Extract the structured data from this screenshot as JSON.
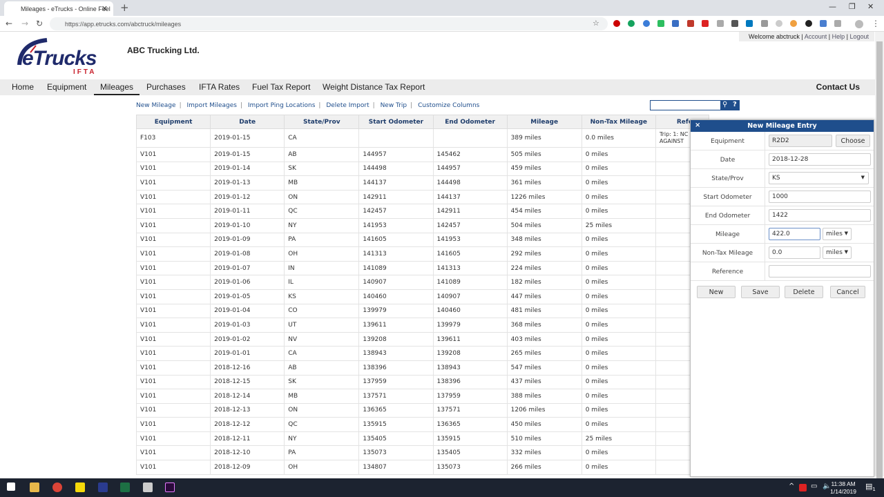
{
  "browser": {
    "tab_title": "Mileages - eTrucks - Online Fuel",
    "url": "https://app.etrucks.com/abctruck/mileages"
  },
  "colors": {
    "brand": "#1f4e8c",
    "accent": "#c8202c"
  },
  "header": {
    "logo_text": "eTrucks",
    "logo_sub": "IFTA",
    "company": "ABC Trucking Ltd.",
    "welcome": "Welcome abctruck",
    "account": "Account",
    "help": "Help",
    "logout": "Logout"
  },
  "menu": {
    "items": [
      "Home",
      "Equipment",
      "Mileages",
      "Purchases",
      "IFTA Rates",
      "Fuel Tax Report",
      "Weight Distance Tax Report"
    ],
    "active": "Mileages",
    "contact": "Contact Us"
  },
  "actions": [
    "New Mileage",
    "Import Mileages",
    "Import Ping Locations",
    "Delete Import",
    "New Trip",
    "Customize Columns"
  ],
  "search": {
    "value": "",
    "search_icon": "search-icon",
    "help": "?"
  },
  "table": {
    "headers": [
      "Equipment",
      "Date",
      "State/Prov",
      "Start Odometer",
      "End Odometer",
      "Mileage",
      "Non-Tax Mileage",
      "Refe"
    ],
    "rows": [
      [
        "F103",
        "2019-01-15",
        "CA",
        "",
        "",
        "389 miles",
        "0.0 miles",
        "Trip: 1: NC AGAINST"
      ],
      [
        "V101",
        "2019-01-15",
        "AB",
        "144957",
        "145462",
        "505 miles",
        "0 miles",
        ""
      ],
      [
        "V101",
        "2019-01-14",
        "SK",
        "144498",
        "144957",
        "459 miles",
        "0 miles",
        ""
      ],
      [
        "V101",
        "2019-01-13",
        "MB",
        "144137",
        "144498",
        "361 miles",
        "0 miles",
        ""
      ],
      [
        "V101",
        "2019-01-12",
        "ON",
        "142911",
        "144137",
        "1226 miles",
        "0 miles",
        ""
      ],
      [
        "V101",
        "2019-01-11",
        "QC",
        "142457",
        "142911",
        "454 miles",
        "0 miles",
        ""
      ],
      [
        "V101",
        "2019-01-10",
        "NY",
        "141953",
        "142457",
        "504 miles",
        "25 miles",
        ""
      ],
      [
        "V101",
        "2019-01-09",
        "PA",
        "141605",
        "141953",
        "348 miles",
        "0 miles",
        ""
      ],
      [
        "V101",
        "2019-01-08",
        "OH",
        "141313",
        "141605",
        "292 miles",
        "0 miles",
        ""
      ],
      [
        "V101",
        "2019-01-07",
        "IN",
        "141089",
        "141313",
        "224 miles",
        "0 miles",
        ""
      ],
      [
        "V101",
        "2019-01-06",
        "IL",
        "140907",
        "141089",
        "182 miles",
        "0 miles",
        ""
      ],
      [
        "V101",
        "2019-01-05",
        "KS",
        "140460",
        "140907",
        "447 miles",
        "0 miles",
        ""
      ],
      [
        "V101",
        "2019-01-04",
        "CO",
        "139979",
        "140460",
        "481 miles",
        "0 miles",
        ""
      ],
      [
        "V101",
        "2019-01-03",
        "UT",
        "139611",
        "139979",
        "368 miles",
        "0 miles",
        ""
      ],
      [
        "V101",
        "2019-01-02",
        "NV",
        "139208",
        "139611",
        "403 miles",
        "0 miles",
        ""
      ],
      [
        "V101",
        "2019-01-01",
        "CA",
        "138943",
        "139208",
        "265 miles",
        "0 miles",
        ""
      ],
      [
        "V101",
        "2018-12-16",
        "AB",
        "138396",
        "138943",
        "547 miles",
        "0 miles",
        ""
      ],
      [
        "V101",
        "2018-12-15",
        "SK",
        "137959",
        "138396",
        "437 miles",
        "0 miles",
        ""
      ],
      [
        "V101",
        "2018-12-14",
        "MB",
        "137571",
        "137959",
        "388 miles",
        "0 miles",
        ""
      ],
      [
        "V101",
        "2018-12-13",
        "ON",
        "136365",
        "137571",
        "1206 miles",
        "0 miles",
        ""
      ],
      [
        "V101",
        "2018-12-12",
        "QC",
        "135915",
        "136365",
        "450 miles",
        "0 miles",
        ""
      ],
      [
        "V101",
        "2018-12-11",
        "NY",
        "135405",
        "135915",
        "510 miles",
        "25 miles",
        ""
      ],
      [
        "V101",
        "2018-12-10",
        "PA",
        "135073",
        "135405",
        "332 miles",
        "0 miles",
        ""
      ],
      [
        "V101",
        "2018-12-09",
        "OH",
        "134807",
        "135073",
        "266 miles",
        "0 miles",
        ""
      ]
    ]
  },
  "dialog": {
    "title": "New Mileage Entry",
    "close": "×",
    "fields": {
      "equipment_label": "Equipment",
      "equipment": "R2D2",
      "choose": "Choose",
      "date_label": "Date",
      "date": "2018-12-28",
      "state_label": "State/Prov",
      "state": "KS",
      "start_label": "Start Odometer",
      "start": "1000",
      "end_label": "End Odometer",
      "end": "1422",
      "mileage_label": "Mileage",
      "mileage": "422.0",
      "mileage_unit": "miles",
      "nontax_label": "Non-Tax Mileage",
      "nontax": "0.0",
      "nontax_unit": "miles",
      "reference_label": "Reference",
      "reference": ""
    },
    "buttons": {
      "new": "New",
      "save": "Save",
      "delete": "Delete",
      "cancel": "Cancel"
    }
  },
  "taskbar": {
    "time": "11:38 AM",
    "date": "1/14/2019",
    "notifications": "1"
  }
}
